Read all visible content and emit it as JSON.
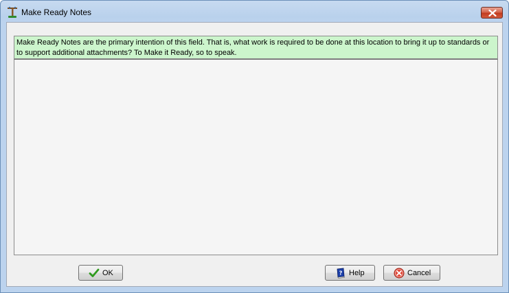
{
  "window": {
    "title": "Make Ready Notes",
    "title_icon": "utility-pole-icon",
    "close_icon": "close-icon"
  },
  "info": {
    "text": "Make Ready Notes are the primary intention of this field. That is, what work is required to be done at this location to bring it up to standards or to support additional attachments? To Make it Ready, so to speak."
  },
  "notes": {
    "value": ""
  },
  "buttons": {
    "ok_label": "OK",
    "ok_icon": "checkmark-icon",
    "help_label": "Help",
    "help_icon": "help-book-icon",
    "cancel_label": "Cancel",
    "cancel_icon": "cancel-circle-icon"
  },
  "colors": {
    "info_background": "#ccf5cc",
    "close_button": "#c23c1f",
    "window_frame": "#bcd3ee"
  }
}
